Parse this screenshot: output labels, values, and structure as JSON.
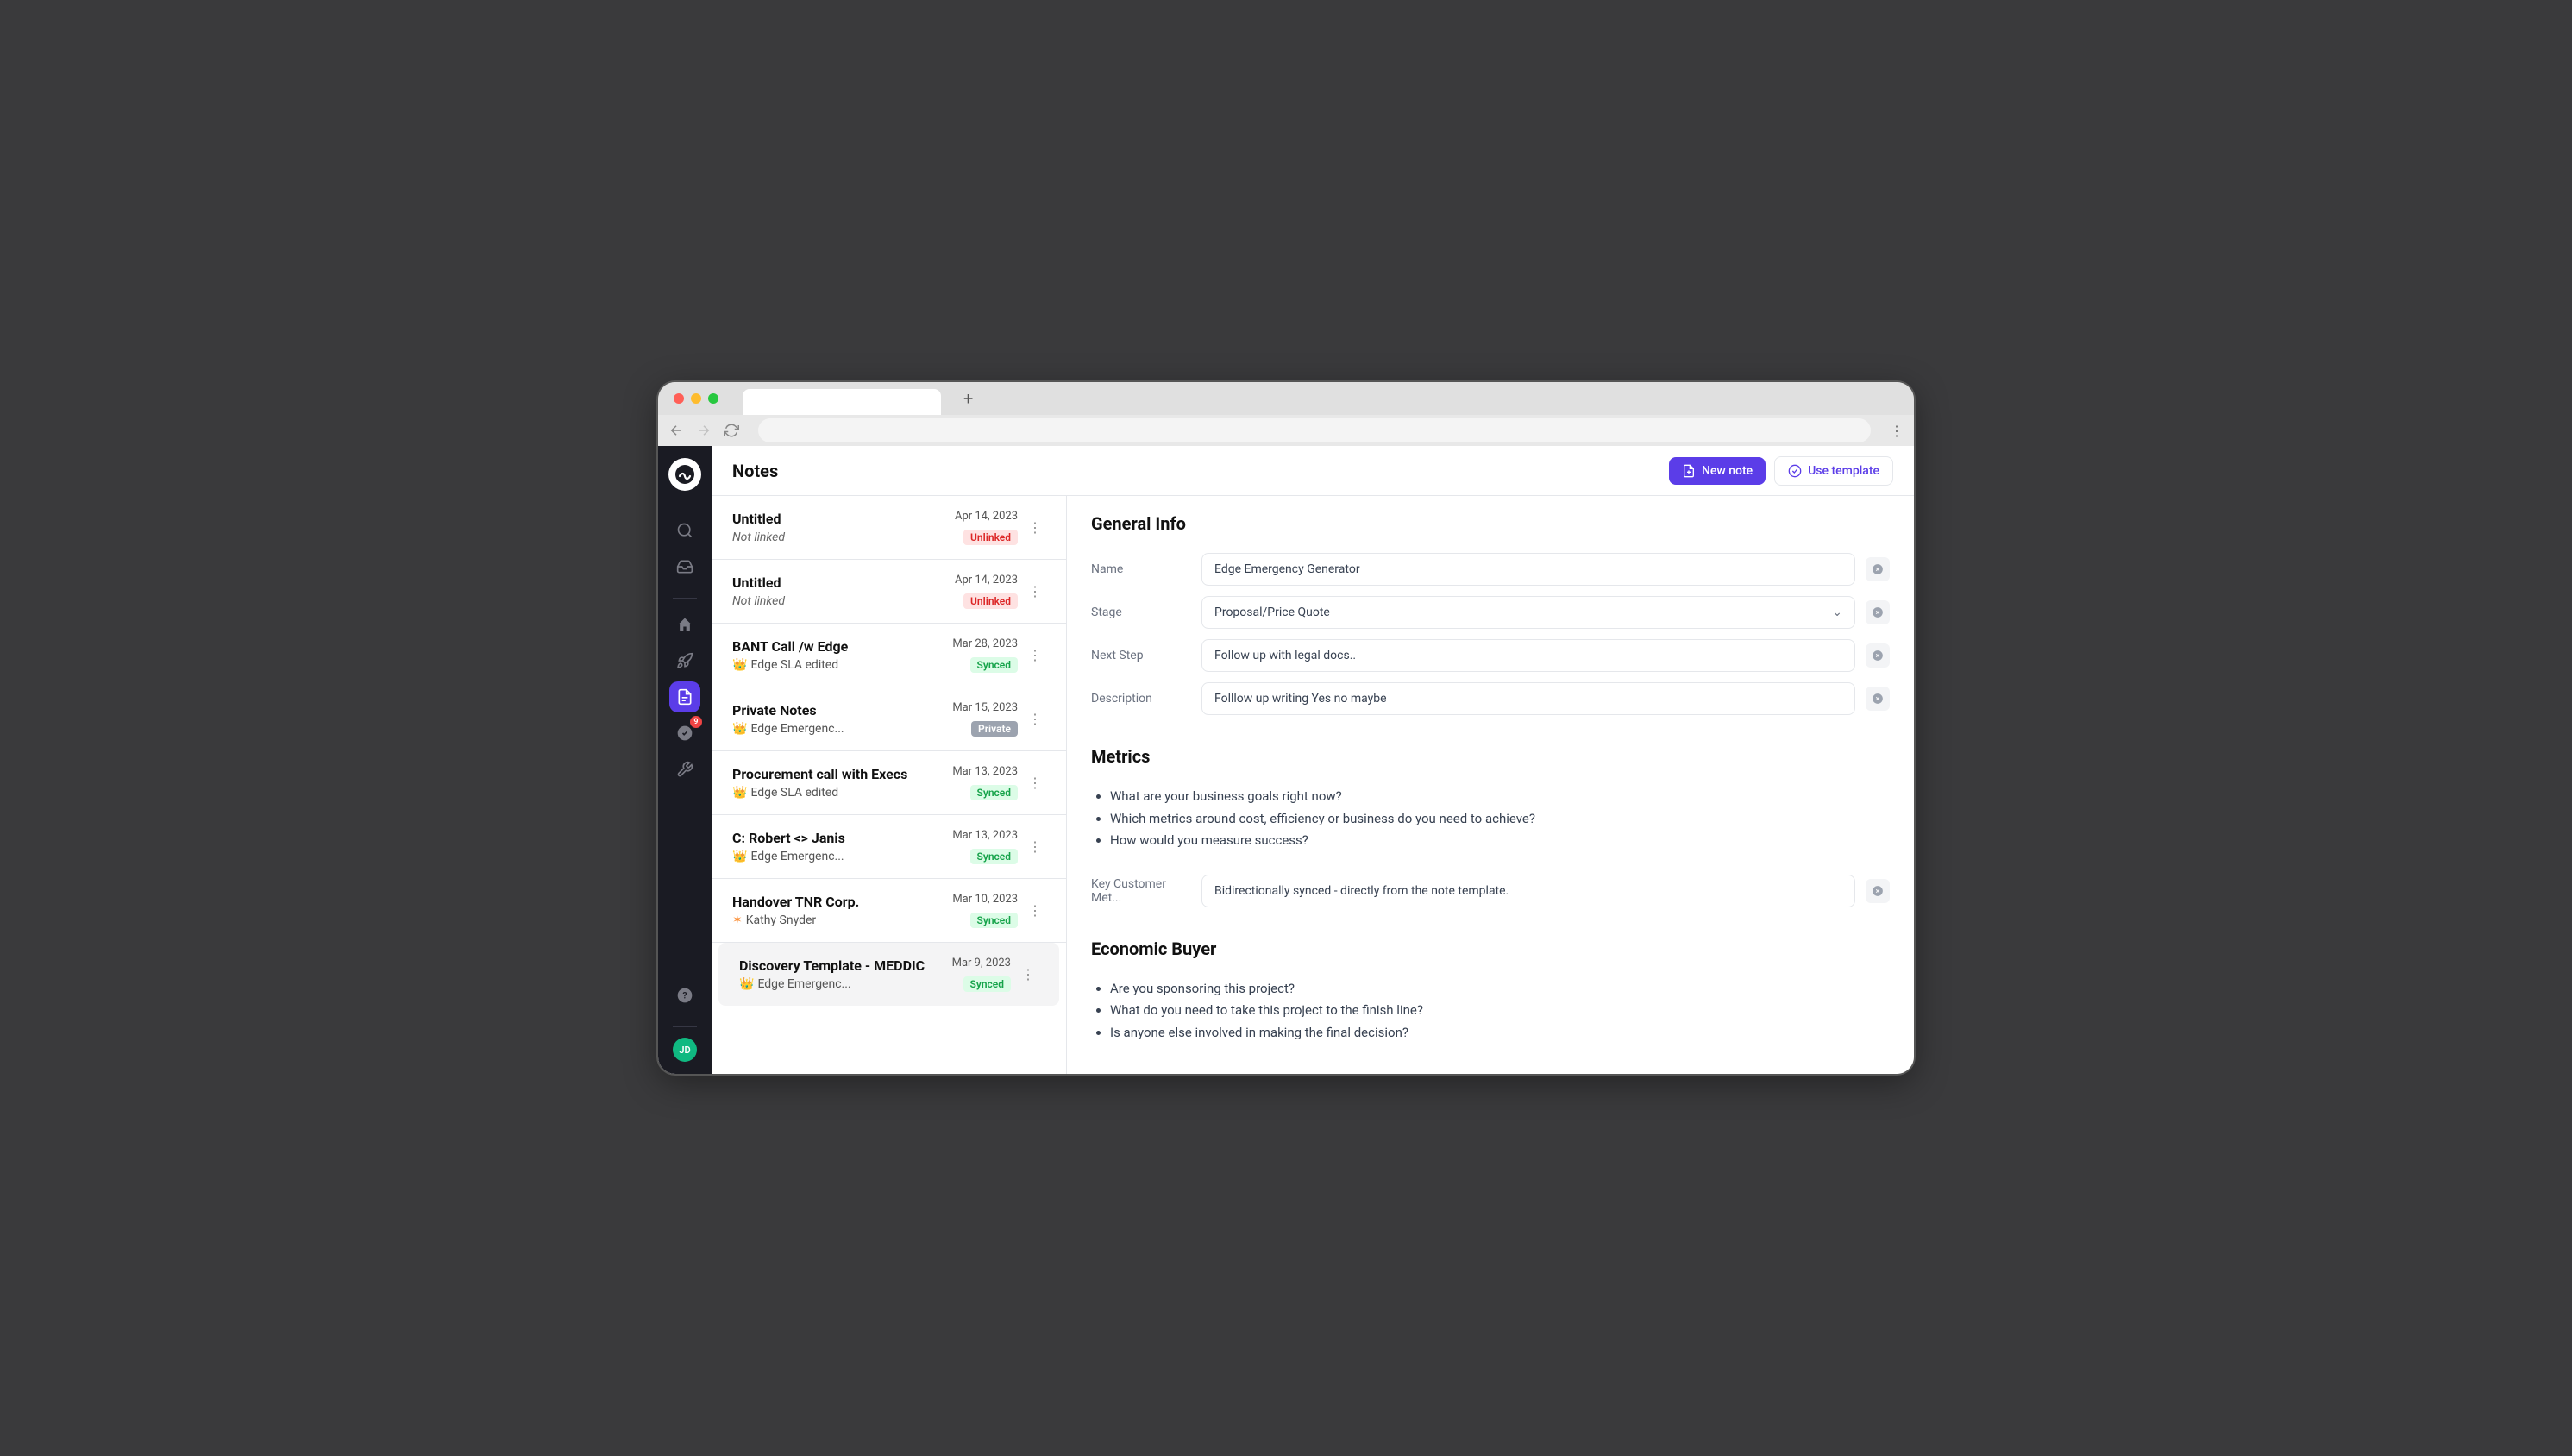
{
  "header": {
    "title": "Notes",
    "new_note": "New note",
    "use_template": "Use template"
  },
  "sidebar": {
    "badge_count": "9",
    "avatar": "JD"
  },
  "notes": [
    {
      "title": "Untitled",
      "link": "Not linked",
      "link_type": "none",
      "date": "Apr 14, 2023",
      "status": "Unlinked",
      "selected": false
    },
    {
      "title": "Untitled",
      "link": "Not linked",
      "link_type": "none",
      "date": "Apr 14, 2023",
      "status": "Unlinked",
      "selected": false
    },
    {
      "title": "BANT Call /w Edge",
      "link": "Edge SLA edited",
      "link_type": "crown",
      "date": "Mar 28, 2023",
      "status": "Synced",
      "selected": false
    },
    {
      "title": "Private Notes",
      "link": "Edge Emergenc...",
      "link_type": "crown",
      "date": "Mar 15, 2023",
      "status": "Private",
      "selected": false
    },
    {
      "title": "Procurement call with Execs",
      "link": "Edge SLA edited",
      "link_type": "crown",
      "date": "Mar 13, 2023",
      "status": "Synced",
      "selected": false
    },
    {
      "title": "C: Robert <> Janis",
      "link": "Edge Emergenc...",
      "link_type": "crown",
      "date": "Mar 13, 2023",
      "status": "Synced",
      "selected": false
    },
    {
      "title": "Handover TNR Corp.",
      "link": "Kathy Snyder",
      "link_type": "star",
      "date": "Mar 10, 2023",
      "status": "Synced",
      "selected": false
    },
    {
      "title": "Discovery Template - MEDDIC",
      "link": "Edge Emergenc...",
      "link_type": "crown",
      "date": "Mar 9, 2023",
      "status": "Synced",
      "selected": true
    }
  ],
  "detail": {
    "general_info": {
      "heading": "General Info",
      "fields": [
        {
          "label": "Name",
          "value": "Edge Emergency Generator",
          "type": "text"
        },
        {
          "label": "Stage",
          "value": "Proposal/Price Quote",
          "type": "select"
        },
        {
          "label": "Next Step",
          "value": "Follow up with legal docs..",
          "type": "text"
        },
        {
          "label": "Description",
          "value": "Folllow up writing Yes no maybe",
          "type": "text"
        }
      ]
    },
    "metrics": {
      "heading": "Metrics",
      "bullets": [
        "What are your business goals right now?",
        "Which metrics around cost, efficiency or business do you need to achieve?",
        "How would you measure success?"
      ],
      "field": {
        "label": "Key Customer Met...",
        "value": "Bidirectionally synced - directly from the note template."
      }
    },
    "economic_buyer": {
      "heading": "Economic Buyer",
      "bullets": [
        "Are you sponsoring this project?",
        "What do you need to take this project to the finish line?",
        "Is anyone else involved in making the final decision?"
      ]
    }
  }
}
